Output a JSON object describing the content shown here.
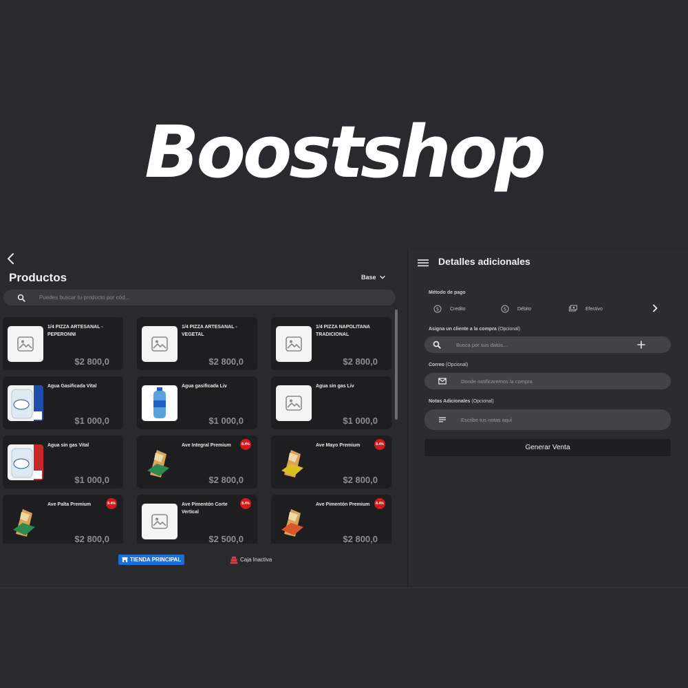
{
  "brand": {
    "name": "Boostshop"
  },
  "products_panel": {
    "title": "Productos",
    "price_list": "Base",
    "search_placeholder": "Puedes buscar tu producto por cód...",
    "items": [
      {
        "name": "1/4 PIZZA ARTESANAL - PEPERONNI",
        "price": "$2 800,0",
        "image": "placeholder-icon",
        "discount": ""
      },
      {
        "name": "1/4 PIZZA ARTESANAL - VEGETAL",
        "price": "$2 800,0",
        "image": "placeholder-icon",
        "discount": ""
      },
      {
        "name": "1/4 PIZZA NAPOLITANA TRADICIONAL",
        "price": "$2 800,0",
        "image": "placeholder-icon",
        "discount": ""
      },
      {
        "name": "Agua Gasificada Vital",
        "price": "$1 000,0",
        "image": "vital-gas-bottle",
        "discount": ""
      },
      {
        "name": "Agua gasificada Liv",
        "price": "$1 000,0",
        "image": "liv-bottle",
        "discount": ""
      },
      {
        "name": "Agua sin gas Liv",
        "price": "$1 000,0",
        "image": "placeholder-icon",
        "discount": ""
      },
      {
        "name": "Agua sin gas Vital",
        "price": "$1 000,0",
        "image": "vital-still-bottle",
        "discount": ""
      },
      {
        "name": "Ave Integral Premium",
        "price": "$2 800,0",
        "image": "sandwich-green",
        "discount": "8.4%"
      },
      {
        "name": "Ave Mayo Premium",
        "price": "$2 800,0",
        "image": "sandwich-yellow",
        "discount": "8.4%"
      },
      {
        "name": "Ave Palta Premium",
        "price": "$2 800,0",
        "image": "sandwich-green",
        "discount": "8.4%"
      },
      {
        "name": "Ave Pimentón Corte Vertical",
        "price": "$2 500,0",
        "image": "placeholder-icon",
        "discount": "8.4%"
      },
      {
        "name": "Ave Pimentón Premium",
        "price": "$2 800,0",
        "image": "sandwich-orange",
        "discount": "8.4%"
      }
    ]
  },
  "status_bar": {
    "store_label": "TIENDA PRINCIPAL",
    "cash_label": "Caja Inactiva",
    "colors": {
      "store_bg": "#1a6ed8",
      "cash_icon": "#e03a3a"
    }
  },
  "details_panel": {
    "title": "Detalles adicionales",
    "payment": {
      "label": "Método de pago",
      "options": [
        {
          "label": "Credito",
          "icon": "dollar-circle-icon"
        },
        {
          "label": "Débito",
          "icon": "dollar-circle-icon"
        },
        {
          "label": "Efectivo",
          "icon": "cash-icon"
        }
      ]
    },
    "customer": {
      "label": "Asigna un cliente a la compra",
      "optional": "(Opcional)",
      "placeholder": "Busca por sus datos..."
    },
    "email": {
      "label": "Correo",
      "optional": "(Opcional)",
      "placeholder": "Donde notificaremos la compra"
    },
    "notes": {
      "label": "Notas Adicionales",
      "optional": "(Opcional)",
      "placeholder": "Escribe tus notas aquí"
    },
    "submit_label": "Generar Venta"
  },
  "colors": {
    "background": "#2a2a2e",
    "card": "#1e1e21",
    "badge": "#d11a1a",
    "field": "#434347"
  }
}
